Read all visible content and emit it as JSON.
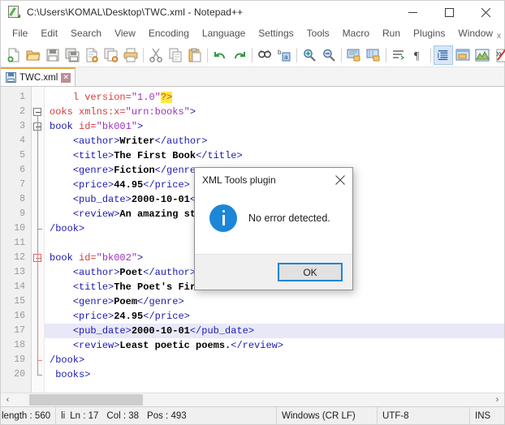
{
  "window": {
    "title": "C:\\Users\\KOMAL\\Desktop\\TWC.xml - Notepad++",
    "icon": "notepadpp-icon",
    "controls": {
      "minimize": "–",
      "maximize": "□",
      "close": "✕"
    }
  },
  "menubar": {
    "items": [
      {
        "label": "File"
      },
      {
        "label": "Edit"
      },
      {
        "label": "Search"
      },
      {
        "label": "View"
      },
      {
        "label": "Encoding"
      },
      {
        "label": "Language"
      },
      {
        "label": "Settings"
      },
      {
        "label": "Tools"
      },
      {
        "label": "Macro"
      },
      {
        "label": "Run"
      },
      {
        "label": "Plugins"
      },
      {
        "label": "Window"
      },
      {
        "label": "?"
      }
    ],
    "close_doc_x": "x"
  },
  "toolbar": {
    "overflow_chevron": "»",
    "buttons": [
      {
        "name": "new-file-icon",
        "title": "New"
      },
      {
        "name": "open-file-icon",
        "title": "Open"
      },
      {
        "name": "save-icon",
        "title": "Save"
      },
      {
        "name": "save-all-icon",
        "title": "Save All"
      },
      {
        "name": "close-file-icon",
        "title": "Close"
      },
      {
        "name": "close-all-icon",
        "title": "Close All"
      },
      {
        "name": "print-icon",
        "title": "Print"
      },
      {
        "name": "cut-icon",
        "title": "Cut"
      },
      {
        "name": "copy-icon",
        "title": "Copy"
      },
      {
        "name": "paste-icon",
        "title": "Paste"
      },
      {
        "name": "undo-icon",
        "title": "Undo"
      },
      {
        "name": "redo-icon",
        "title": "Redo"
      },
      {
        "name": "find-icon",
        "title": "Find"
      },
      {
        "name": "replace-icon",
        "title": "Replace"
      },
      {
        "name": "zoom-in-icon",
        "title": "Zoom In"
      },
      {
        "name": "zoom-out-icon",
        "title": "Zoom Out"
      },
      {
        "name": "sync-vertical-icon",
        "title": "Sync Vertical Scrolling"
      },
      {
        "name": "sync-horizontal-icon",
        "title": "Sync Horizontal Scrolling"
      },
      {
        "name": "word-wrap-icon",
        "title": "Word Wrap"
      },
      {
        "name": "show-all-chars-icon",
        "title": "Show All Characters"
      },
      {
        "name": "indent-guide-icon",
        "title": "Indent Guide",
        "active": true
      },
      {
        "name": "user-defined-dialog-icon",
        "title": "User Defined Dialogue"
      },
      {
        "name": "document-map-icon",
        "title": "Document Map"
      },
      {
        "name": "function-list-icon",
        "title": "Function List"
      }
    ]
  },
  "tabs": [
    {
      "label": "TWC.xml",
      "icon": "saved-file-icon",
      "close": "✕",
      "active": true
    }
  ],
  "editor": {
    "line_count": 20,
    "current_line": 17,
    "lines": [
      {
        "num": 1,
        "segments": [
          {
            "t": "    ",
            "c": "plain"
          },
          {
            "t": "l",
            "c": "attn"
          },
          {
            "t": " ",
            "c": "plain"
          },
          {
            "t": "version",
            "c": "attn"
          },
          {
            "t": "=",
            "c": "attn"
          },
          {
            "t": "\"1.0\"",
            "c": "attv"
          },
          {
            "t": "?>",
            "c": "hl"
          }
        ]
      },
      {
        "num": 2,
        "segments": [
          {
            "t": "ooks ",
            "c": "attn"
          },
          {
            "t": "xmlns:x",
            "c": "attn"
          },
          {
            "t": "=",
            "c": "attn"
          },
          {
            "t": "\"urn:books\"",
            "c": "attv"
          },
          {
            "t": ">",
            "c": "tg"
          }
        ]
      },
      {
        "num": 3,
        "segments": [
          {
            "t": "book ",
            "c": "tg"
          },
          {
            "t": "id",
            "c": "attn"
          },
          {
            "t": "=",
            "c": "attn"
          },
          {
            "t": "\"bk001\"",
            "c": "attv"
          },
          {
            "t": ">",
            "c": "tg"
          }
        ]
      },
      {
        "num": 4,
        "segments": [
          {
            "t": "    ",
            "c": "plain"
          },
          {
            "t": "<author>",
            "c": "tg"
          },
          {
            "t": "Writer",
            "c": "txt"
          },
          {
            "t": "</author>",
            "c": "tg"
          }
        ]
      },
      {
        "num": 5,
        "segments": [
          {
            "t": "    ",
            "c": "plain"
          },
          {
            "t": "<title>",
            "c": "tg"
          },
          {
            "t": "The First Book",
            "c": "txt"
          },
          {
            "t": "</title>",
            "c": "tg"
          }
        ]
      },
      {
        "num": 6,
        "segments": [
          {
            "t": "    ",
            "c": "plain"
          },
          {
            "t": "<genre>",
            "c": "tg"
          },
          {
            "t": "Fiction",
            "c": "txt"
          },
          {
            "t": "</genre>",
            "c": "tg"
          }
        ]
      },
      {
        "num": 7,
        "segments": [
          {
            "t": "    ",
            "c": "plain"
          },
          {
            "t": "<price>",
            "c": "tg"
          },
          {
            "t": "44.95",
            "c": "txt"
          },
          {
            "t": "</price>",
            "c": "tg"
          }
        ]
      },
      {
        "num": 8,
        "segments": [
          {
            "t": "    ",
            "c": "plain"
          },
          {
            "t": "<pub_date>",
            "c": "tg"
          },
          {
            "t": "2000-10-01",
            "c": "txt"
          },
          {
            "t": "</pub_date>",
            "c": "tg"
          }
        ]
      },
      {
        "num": 9,
        "segments": [
          {
            "t": "    ",
            "c": "plain"
          },
          {
            "t": "<review>",
            "c": "tg"
          },
          {
            "t": "An amazing story.",
            "c": "txt"
          },
          {
            "t": "</review>",
            "c": "tg"
          }
        ]
      },
      {
        "num": 10,
        "segments": [
          {
            "t": "/book>",
            "c": "tg"
          }
        ]
      },
      {
        "num": 11,
        "segments": []
      },
      {
        "num": 12,
        "segments": [
          {
            "t": "book ",
            "c": "tg"
          },
          {
            "t": "id",
            "c": "attn"
          },
          {
            "t": "=",
            "c": "attn"
          },
          {
            "t": "\"bk002\"",
            "c": "attv"
          },
          {
            "t": ">",
            "c": "tg"
          }
        ]
      },
      {
        "num": 13,
        "segments": [
          {
            "t": "    ",
            "c": "plain"
          },
          {
            "t": "<author>",
            "c": "tg"
          },
          {
            "t": "Poet",
            "c": "txt"
          },
          {
            "t": "</author>",
            "c": "tg"
          }
        ]
      },
      {
        "num": 14,
        "segments": [
          {
            "t": "    ",
            "c": "plain"
          },
          {
            "t": "<title>",
            "c": "tg"
          },
          {
            "t": "The Poet's First",
            "c": "txt"
          },
          {
            "t": "</title>",
            "c": "tg"
          }
        ]
      },
      {
        "num": 15,
        "segments": [
          {
            "t": "    ",
            "c": "plain"
          },
          {
            "t": "<genre>",
            "c": "tg"
          },
          {
            "t": "Poem",
            "c": "txt"
          },
          {
            "t": "</genre>",
            "c": "tg"
          }
        ]
      },
      {
        "num": 16,
        "segments": [
          {
            "t": "    ",
            "c": "plain"
          },
          {
            "t": "<price>",
            "c": "tg"
          },
          {
            "t": "24.95",
            "c": "txt"
          },
          {
            "t": "</price>",
            "c": "tg"
          }
        ]
      },
      {
        "num": 17,
        "segments": [
          {
            "t": "    ",
            "c": "plain"
          },
          {
            "t": "<pub_date>",
            "c": "tg"
          },
          {
            "t": "2000-10-01",
            "c": "txt"
          },
          {
            "t": "</pub_date>",
            "c": "tg"
          }
        ]
      },
      {
        "num": 18,
        "segments": [
          {
            "t": "    ",
            "c": "plain"
          },
          {
            "t": "<review>",
            "c": "tg"
          },
          {
            "t": "Least poetic poems.",
            "c": "txt"
          },
          {
            "t": "</review>",
            "c": "tg"
          }
        ]
      },
      {
        "num": 19,
        "segments": [
          {
            "t": "/book>",
            "c": "tg"
          }
        ]
      },
      {
        "num": 20,
        "segments": [
          {
            "t": " books>",
            "c": "tg"
          }
        ]
      }
    ],
    "folds": [
      {
        "line": 2,
        "type": "open",
        "color": "grey"
      },
      {
        "line": 3,
        "type": "open",
        "color": "grey"
      },
      {
        "line": 10,
        "type": "end",
        "color": "grey"
      },
      {
        "line": 12,
        "type": "open",
        "color": "red"
      },
      {
        "line": 19,
        "type": "end",
        "color": "red"
      },
      {
        "line": 20,
        "type": "end",
        "color": "grey"
      }
    ]
  },
  "hscroll": {
    "left_arrow": "‹",
    "right_arrow": "›"
  },
  "statusbar": {
    "length": "length : 560",
    "lines": "li",
    "ln": "Ln : 17",
    "col": "Col : 38",
    "pos": "Pos : 493",
    "eol": "Windows (CR LF)",
    "encoding": "UTF-8",
    "insert_mode": "INS"
  },
  "dialog": {
    "title": "XML Tools plugin",
    "close_label": "✕",
    "message": "No error detected.",
    "icon": "info-icon",
    "ok_label": "OK"
  },
  "colors": {
    "accent_blue": "#1c86d8",
    "tab_orange": "#e8a33d",
    "tag_blue": "#1a1ab0",
    "attr_red": "#d43c3c",
    "attr_value_purple": "#9b30c0",
    "highlight_yellow": "#ffe93f",
    "current_line": "#e8e8f8"
  }
}
